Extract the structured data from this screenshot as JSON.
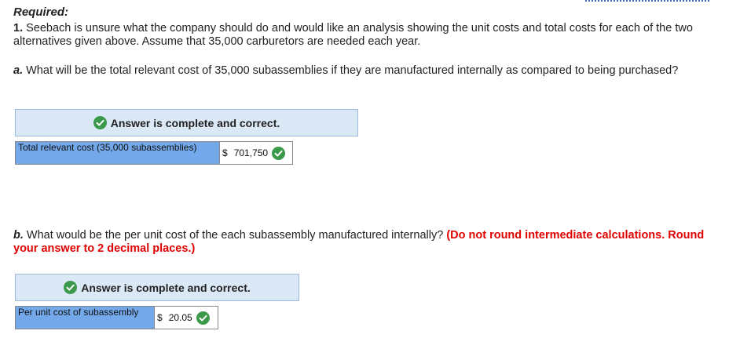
{
  "heading": "Required:",
  "intro": {
    "num": "1.",
    "text": "Seebach is unsure what the company should do and would like an analysis showing the unit costs and total costs for each of the two alternatives given above. Assume that 35,000 carburetors are needed each year."
  },
  "part_a": {
    "letter": "a.",
    "question": "What will be the total relevant cost of 35,000 subassemblies if they are manufactured internally as compared to being purchased?",
    "banner": "Answer is complete and correct.",
    "row_label": "Total relevant cost (35,000 subassemblies)",
    "currency": "$",
    "value": "701,750"
  },
  "part_b": {
    "letter": "b.",
    "question": "What would be the per unit cost of the each subassembly manufactured internally?",
    "instruction": "(Do not round intermediate calculations. Round your answer to 2 decimal places.)",
    "banner": "Answer is complete and correct.",
    "row_label": "Per unit cost of subassembly",
    "currency": "$",
    "value": "20.05"
  },
  "colors": {
    "check_green": "#3b9a4a",
    "label_blue": "#73a9ea",
    "banner_bg": "#dbe8f6",
    "instruction_red": "#e00000"
  },
  "icons": {
    "banner_check": "check-circle-icon",
    "value_check": "check-circle-icon"
  }
}
